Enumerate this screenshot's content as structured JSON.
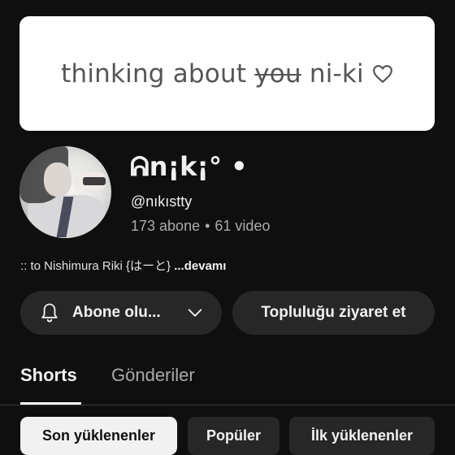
{
  "banner": {
    "text_before": "thinking about ",
    "text_struck": "you",
    "text_after": " ni-ki"
  },
  "channel": {
    "name": "ᕱn¡k¡° •",
    "handle": "@nıkıstty",
    "subscribers": "173 abone",
    "separator": "•",
    "videos": "61 video",
    "description": ":: to Nishimura Riki {はーと}",
    "more_label": "...devamı"
  },
  "actions": {
    "subscribe_label": "Abone olu...",
    "community_label": "Topluluğu ziyaret et"
  },
  "tabs": [
    {
      "label": "Shorts",
      "active": true
    },
    {
      "label": "Gönderiler",
      "active": false
    }
  ],
  "sort_chips": [
    {
      "label": "Son yüklenenler",
      "active": true
    },
    {
      "label": "Popüler",
      "active": false
    },
    {
      "label": "İlk yüklenenler",
      "active": false
    }
  ],
  "icons": {
    "banner_heart": "heart-outline-icon",
    "bell": "bell-icon",
    "dropdown": "chevron-down-icon"
  },
  "colors": {
    "background": "#0f0f0f",
    "surface": "#272727",
    "text_primary": "#f1f1f1",
    "text_secondary": "#aaaaaa",
    "active_chip": "#f1f1f1"
  }
}
